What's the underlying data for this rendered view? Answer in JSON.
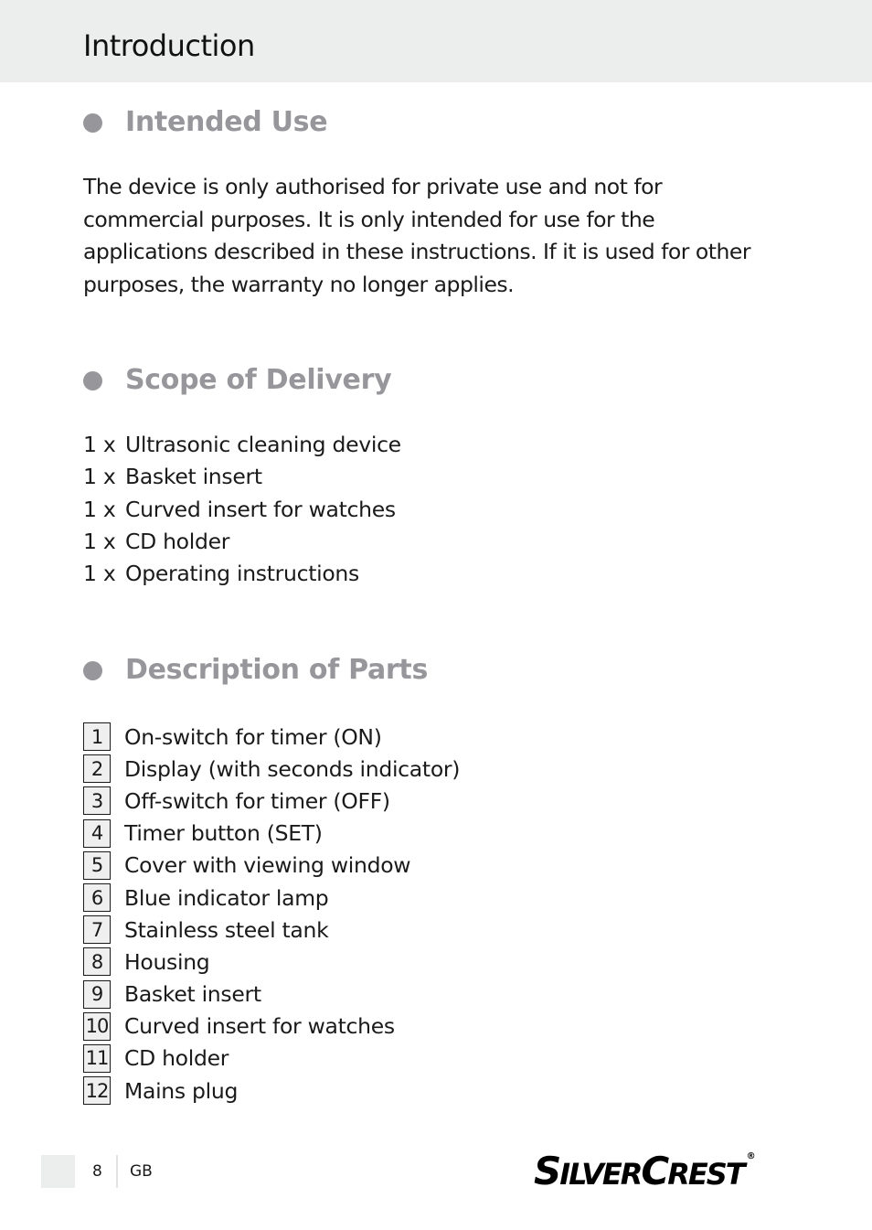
{
  "header": {
    "title": "Introduction",
    "band_color": "#eceeed"
  },
  "sections": {
    "intended_use": {
      "heading": "Intended Use",
      "paragraph": "The device is only authorised for private use and not for commercial purposes. It is only intended for use for the applications described in these instructions. If it is used for other purposes, the warranty no longer applies."
    },
    "scope_of_delivery": {
      "heading": "Scope of Delivery",
      "items": [
        {
          "qty": "1 x",
          "label": "Ultrasonic cleaning device"
        },
        {
          "qty": "1 x",
          "label": "Basket insert"
        },
        {
          "qty": "1 x",
          "label": "Curved insert for watches"
        },
        {
          "qty": "1 x",
          "label": "CD holder"
        },
        {
          "qty": "1 x",
          "label": "Operating instructions"
        }
      ]
    },
    "description_of_parts": {
      "heading": "Description of Parts",
      "items": [
        {
          "num": "1",
          "label": "On-switch for timer (ON)"
        },
        {
          "num": "2",
          "label": "Display (with seconds indicator)"
        },
        {
          "num": "3",
          "label": "Off-switch for timer (OFF)"
        },
        {
          "num": "4",
          "label": "Timer button (SET)"
        },
        {
          "num": "5",
          "label": "Cover with viewing window"
        },
        {
          "num": "6",
          "label": "Blue indicator lamp"
        },
        {
          "num": "7",
          "label": "Stainless steel tank"
        },
        {
          "num": "8",
          "label": "Housing"
        },
        {
          "num": "9",
          "label": "Basket insert"
        },
        {
          "num": "10",
          "label": "Curved insert for watches"
        },
        {
          "num": "11",
          "label": "CD holder"
        },
        {
          "num": "12",
          "label": "Mains plug"
        }
      ]
    }
  },
  "heading_color": "#97979b",
  "footer": {
    "page_number": "8",
    "language": "GB",
    "brand": {
      "s_cap": "S",
      "ilver": "ILVER",
      "c_cap": "C",
      "rest": "REST",
      "registered": "®"
    }
  }
}
